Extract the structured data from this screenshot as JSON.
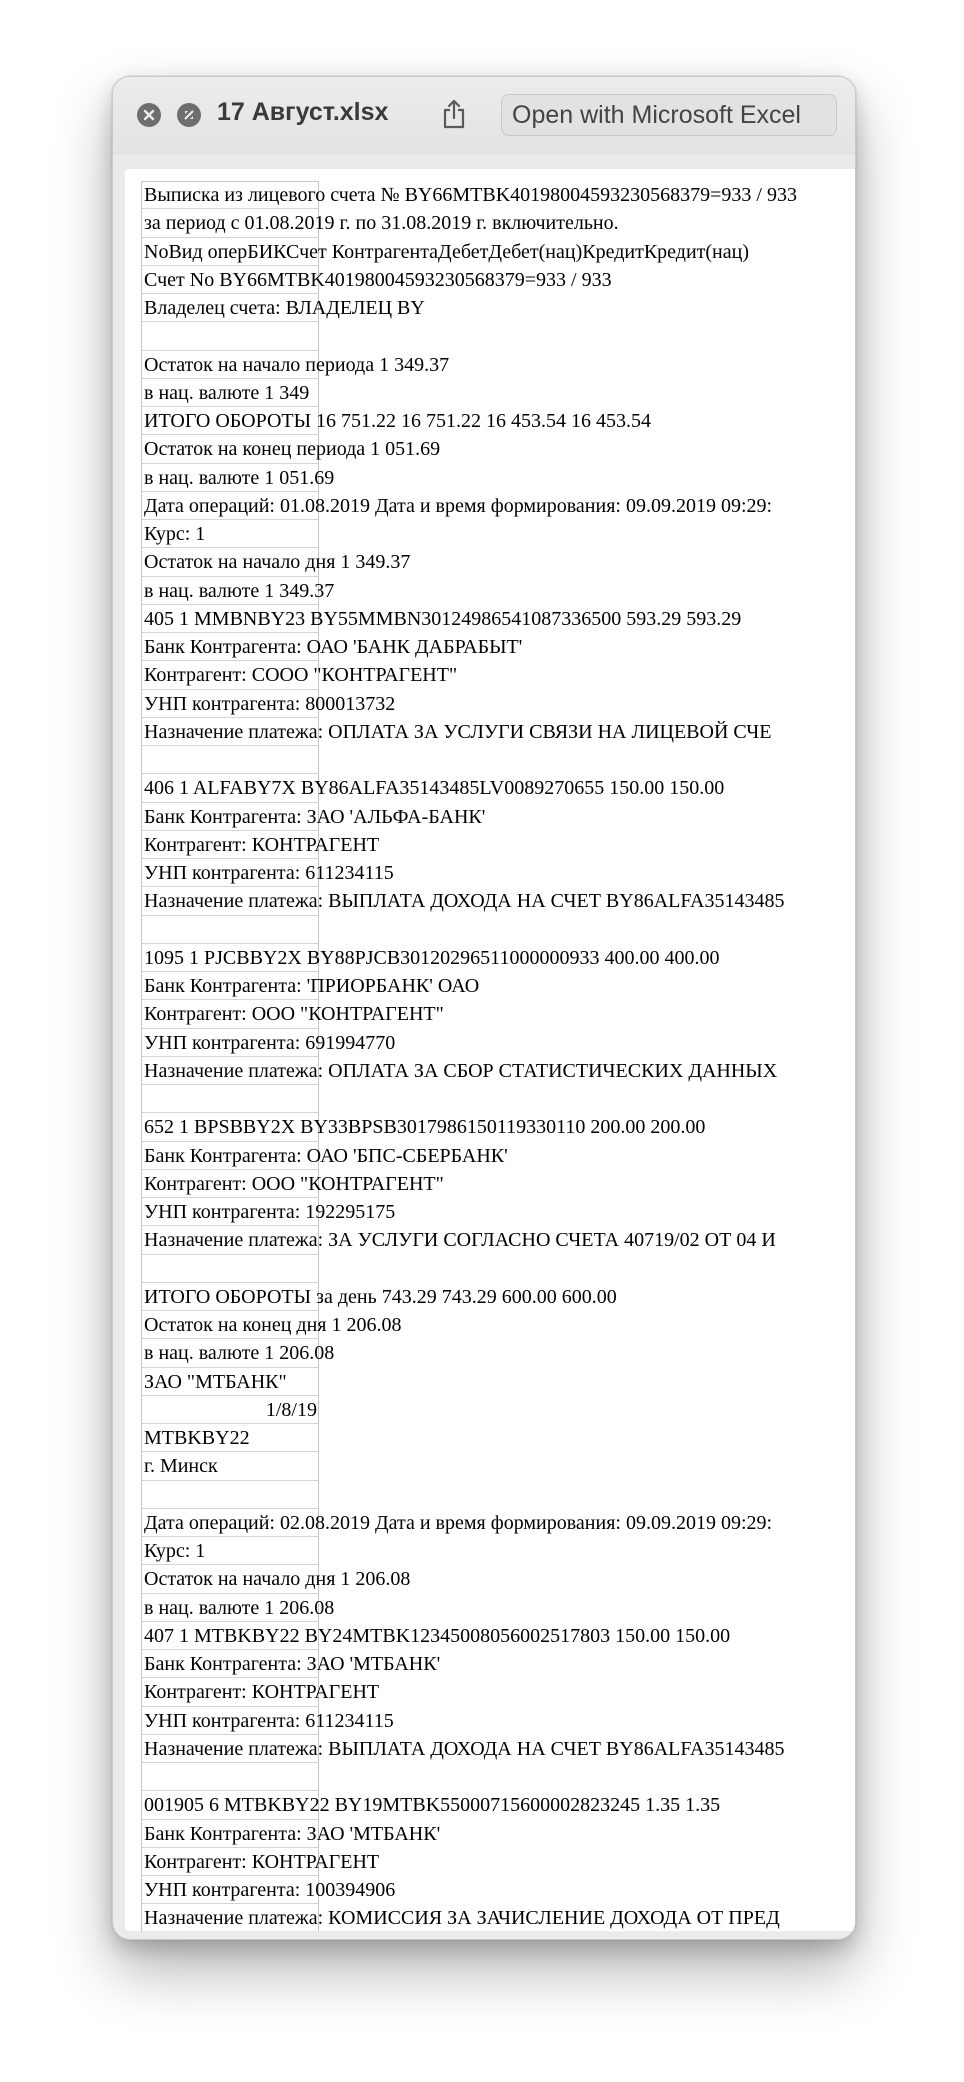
{
  "window": {
    "title": "17 Август.xlsx",
    "open_button_label": "Open with Microsoft Excel"
  },
  "icons": {
    "close": "close-icon",
    "fullscreen": "fullscreen-icon",
    "share": "share-icon"
  },
  "sheet": {
    "rows": [
      "Выписка из лицевого счета № BY66MTBK40198004593230568379=933 / 933",
      "за период с 01.08.2019 г. по 31.08.2019 г. включительно.",
      "NoВид оперБИКСчет КонтрагентаДебетДебет(нац)КредитКредит(нац)",
      "Счет No BY66MTBK40198004593230568379=933 / 933",
      "Владелец счета: ВЛАДЕЛЕЦ BY",
      "",
      "Остаток на начало периода 1 349.37",
      "в нац. валюте 1 349",
      "ИТОГО ОБОРОТЫ 16 751.22 16 751.22 16 453.54 16 453.54",
      "Остаток на конец периода 1 051.69",
      "в нац. валюте 1 051.69",
      "Дата операций: 01.08.2019    Дата и время формирования: 09.09.2019 09:29:",
      "Курс: 1",
      "Остаток на начало дня 1 349.37",
      "в нац. валюте 1 349.37",
      " 405  1  MMBNBY23  BY55MMBN30124986541087336500  593.29  593.29",
      "Банк Контрагента: ОАО 'БАНК ДАБРАБЫТ'",
      "Контрагент: СООО \"КОНТРАГЕНТ\"",
      "УНП контрагента: 800013732",
      "Назначение платежа: ОПЛАТА ЗА УСЛУГИ СВЯЗИ НА ЛИЦЕВОЙ СЧЕ",
      "",
      " 406  1  ALFABY7X  BY86ALFA35143485LV0089270655  150.00  150.00",
      "Банк Контрагента: ЗАО 'АЛЬФА-БАНК'",
      "Контрагент: КОНТРАГЕНТ",
      "УНП контрагента: 611234115",
      "Назначение платежа: ВЫПЛАТА ДОХОДА НА СЧЕТ BY86ALFA35143485",
      "",
      " 1095  1  PJCBBY2X  BY88PJCB30120296511000000933      400.00  400.00",
      "Банк Контрагента: 'ПРИОРБАНК' ОАО",
      "Контрагент: ООО \"КОНТРАГЕНТ\"",
      "УНП контрагента: 691994770",
      "Назначение платежа: ОПЛАТА ЗА СБОР СТАТИСТИЧЕСКИХ ДАННЫХ",
      "",
      " 652  1  BPSBBY2X  BY33BPSB3017986150119330110      200.00  200.00",
      "Банк Контрагента: ОАО 'БПС-СБЕРБАНК'",
      "Контрагент: ООО \"КОНТРАГЕНТ\"",
      "УНП контрагента: 192295175",
      "Назначение платежа: ЗА УСЛУГИ СОГЛАСНО СЧЕТА 40719/02 ОТ 04 И",
      "",
      "ИТОГО ОБОРОТЫ за день 743.29 743.29 600.00 600.00",
      "Остаток на конец дня 1 206.08",
      "в нац. валюте 1 206.08",
      "ЗАО \"МТБАНК\"",
      "1/8/19",
      "MTBKBY22",
      "г. Минск",
      "",
      "Дата операций: 02.08.2019    Дата и время формирования: 09.09.2019 09:29:",
      "Курс: 1",
      "Остаток на начало дня 1 206.08",
      "в нац. валюте 1 206.08",
      " 407  1  MTBKBY22  BY24MTBK12345008056002517803  150.00  150.00",
      "Банк Контрагента: ЗАО 'МТБАНК'",
      "Контрагент: КОНТРАГЕНТ",
      "УНП контрагента: 611234115",
      "Назначение платежа: ВЫПЛАТА ДОХОДА НА СЧЕТ BY86ALFA35143485",
      "",
      " 001905  6  MTBKBY22  BY19MTBK55000715600002823245  1.35  1.35",
      "Банк Контрагента: ЗАО 'МТБАНК'",
      "Контрагент: КОНТРАГЕНТ",
      "УНП контрагента: 100394906",
      "Назначение платежа: КОМИССИЯ ЗА ЗАЧИСЛЕНИЕ ДОХОДА ОТ ПРЕД",
      ""
    ]
  }
}
